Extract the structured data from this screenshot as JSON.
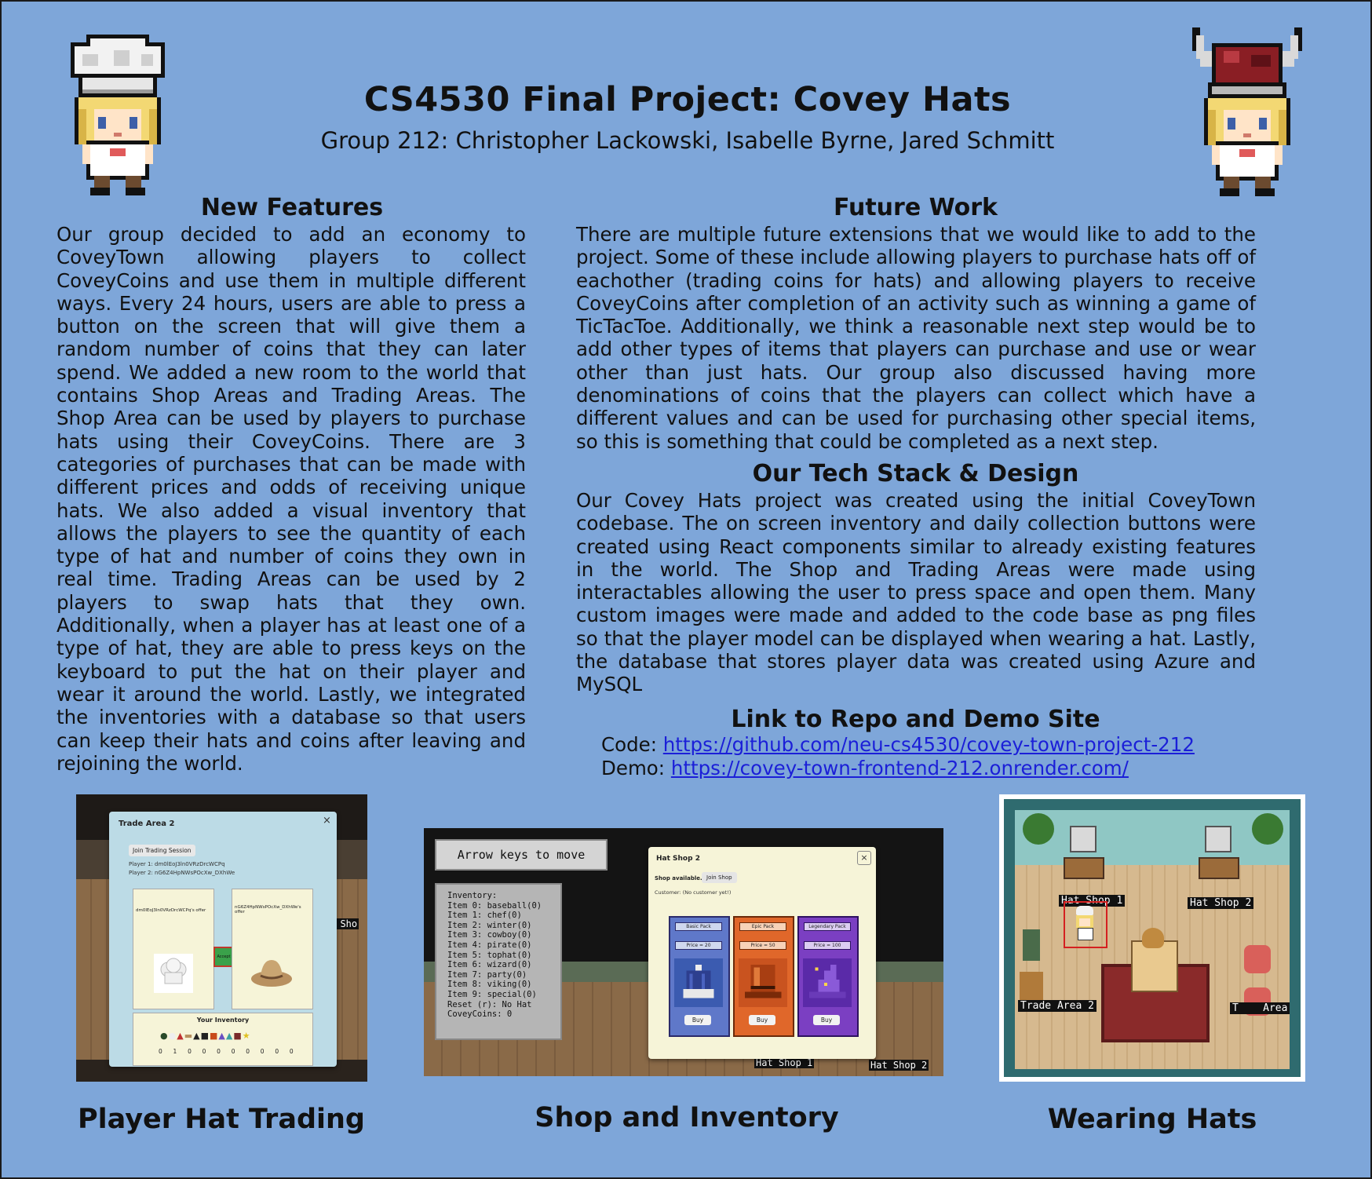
{
  "poster": {
    "title": "CS4530 Final Project: Covey Hats",
    "subtitle": "Group 212: Christopher Lackowski, Isabelle Byrne, Jared Schmitt"
  },
  "new_features": {
    "heading": "New Features",
    "body": "Our group decided to add an economy to CoveyTown allowing players to collect CoveyCoins and use them in multiple different ways. Every 24 hours, users are able to press a button on the screen that will give them a random number of coins that they can later spend. We added a new room to the world that contains Shop Areas and Trading Areas. The Shop Area can be used by players to purchase hats using their CoveyCoins. There are 3 categories of purchases that can be made with different prices and odds of receiving unique hats. We also added a visual inventory that allows the players to see the quantity of each type of hat and number of coins they own in real time. Trading Areas can be used by 2 players to swap hats that they own. Additionally, when a player has at least one of a type of hat, they are able to press keys on the keyboard to put the hat on their player and wear it around the world. Lastly, we integrated the inventories with a database so that users can keep their hats and coins after leaving and rejoining the world."
  },
  "future_work": {
    "heading": "Future Work",
    "body": "There are multiple future extensions that we would like to add to the project. Some of these include allowing players to purchase hats off of eachother (trading coins for hats) and allowing players to receive CoveyCoins after completion of an activity such as winning a game of TicTacToe. Additionally, we think a reasonable next step would be to add other types of items that players can purchase and use or wear other than just hats. Our group also discussed having more denominations of coins that the players can collect which have a different values and can be used for purchasing other special items, so this is something that could be completed as a next step."
  },
  "tech_stack": {
    "heading": "Our Tech Stack & Design",
    "body": "Our Covey Hats project was created using the initial CoveyTown codebase. The on screen inventory and daily collection buttons were created using React components similar to already existing features in the world. The Shop and Trading Areas were made using interactables allowing the user to press space and open them. Many custom images were made and added to the code base as png files so that the player model can be displayed when wearing a hat. Lastly, the database that stores player data was created using Azure and MySQL"
  },
  "links": {
    "heading": "Link to Repo and Demo Site",
    "code_label": "Code:",
    "code_url": "https://github.com/neu-cs4530/covey-town-project-212",
    "demo_label": "Demo:",
    "demo_url": "https://covey-town-frontend-212.onrender.com/"
  },
  "captions": {
    "trading": "Player Hat Trading",
    "shop": "Shop and Inventory",
    "wearing": "Wearing Hats"
  },
  "trade_modal": {
    "title": "Trade Area 2",
    "close": "×",
    "join_button": "Join Trading Session",
    "player1": "Player 1: dm0lEoJ3ln0VRzDrcWCPq",
    "player2": "Player 2: nG6Z4HpNWsPOcXw_DXhWe",
    "offer1": "dm0lEoJ3ln0VRzDrcWCPq's offer",
    "offer2": "nG6Z4HpNWsPOcXw_DXhWe's offer",
    "accept": "Accept",
    "inventory_title": "Your Inventory",
    "inventory_counts": "0  1  0  0  0  0  0  0  0  0",
    "bg_label": "t Sho"
  },
  "shop_screen": {
    "arrow_hint": "Arrow keys to move",
    "inventory_lines": [
      "Inventory:",
      "Item 0: baseball(0)",
      "Item 1: chef(0)",
      "Item 2: winter(0)",
      "Item 3: cowboy(0)",
      "Item 4: pirate(0)",
      "Item 5: tophat(0)",
      "Item 6: wizard(0)",
      "Item 7: party(0)",
      "Item 8: viking(0)",
      "Item 9: special(0)",
      "Reset (r): No Hat",
      "CoveyCoins: 0"
    ],
    "modal_title": "Hat Shop 2",
    "close": "×",
    "shop_available": "Shop available.",
    "join_shop": "Join Shop",
    "customer": "Customer: (No customer yet!)",
    "packs": [
      {
        "name": "Basic Pack",
        "price": "Price = 20",
        "buy": "Buy",
        "color": "#5f78c9",
        "icon": "winter-hat-icon"
      },
      {
        "name": "Epic Pack",
        "price": "Price = 50",
        "buy": "Buy",
        "color": "#e0672a",
        "icon": "tophat-icon"
      },
      {
        "name": "Legendary Pack",
        "price": "Price = 100",
        "buy": "Buy",
        "color": "#7b3fc2",
        "icon": "wizard-hat-icon"
      }
    ],
    "label_shop1": "Hat Shop 1",
    "label_shop2": "Hat Shop 2"
  },
  "wearing_screen": {
    "label_shop1": "Hat Shop 1",
    "label_shop2": "Hat Shop 2",
    "label_trade2": "Trade Area 2",
    "label_trade_right": "T    Area"
  }
}
